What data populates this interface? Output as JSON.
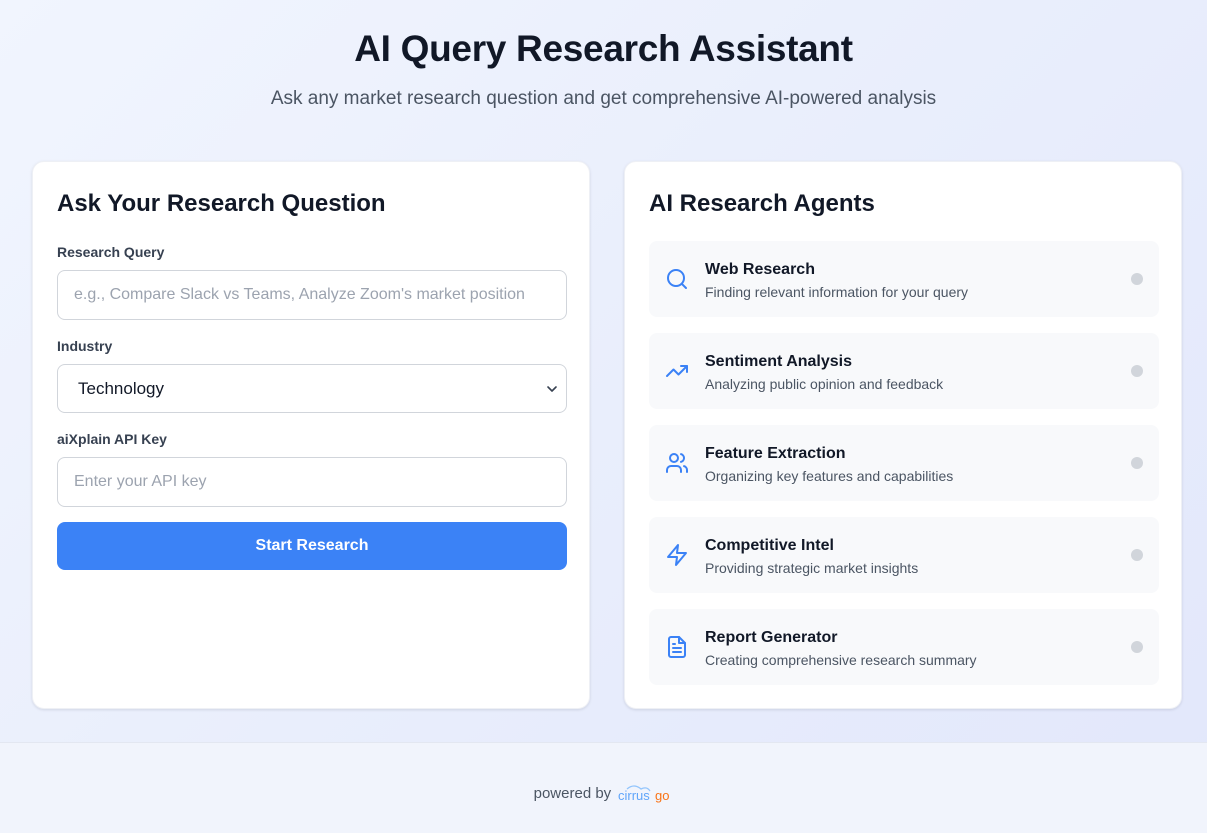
{
  "header": {
    "title": "AI Query Research Assistant",
    "subtitle": "Ask any market research question and get comprehensive AI-powered analysis"
  },
  "form": {
    "title": "Ask Your Research Question",
    "query_label": "Research Query",
    "query_placeholder": "e.g., Compare Slack vs Teams, Analyze Zoom's market position",
    "query_value": "",
    "industry_label": "Industry",
    "industry_value": "Technology",
    "api_key_label": "aiXplain API Key",
    "api_key_placeholder": "Enter your API key",
    "api_key_value": "",
    "submit_label": "Start Research",
    "accent_color": "#3b82f6"
  },
  "agents": {
    "title": "AI Research Agents",
    "items": [
      {
        "name": "Web Research",
        "description": "Finding relevant information for your query",
        "icon": "search-icon",
        "status": "idle"
      },
      {
        "name": "Sentiment Analysis",
        "description": "Analyzing public opinion and feedback",
        "icon": "trending-up-icon",
        "status": "idle"
      },
      {
        "name": "Feature Extraction",
        "description": "Organizing key features and capabilities",
        "icon": "users-icon",
        "status": "idle"
      },
      {
        "name": "Competitive Intel",
        "description": "Providing strategic market insights",
        "icon": "lightning-icon",
        "status": "idle"
      },
      {
        "name": "Report Generator",
        "description": "Creating comprehensive research summary",
        "icon": "document-icon",
        "status": "idle"
      }
    ]
  },
  "footer": {
    "powered_by": "powered by",
    "brand": "cirrusgo",
    "brand_colors": [
      "#60a5fa",
      "#f97316"
    ]
  }
}
